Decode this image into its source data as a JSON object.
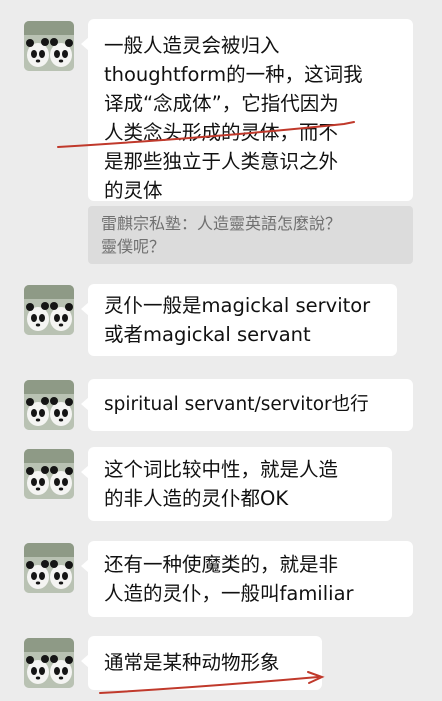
{
  "messages": [
    {
      "lines": [
        "一般人造灵会被归入",
        "thoughtform的一种，这词我",
        "译成“念成体”，它指代因为",
        "人类念头形成的灵体，而不",
        "是那些独立于人类意识之外",
        "的灵体"
      ],
      "quote": {
        "lines": [
          "雷麒宗私塾：人造靈英語怎麼說？",
          "靈僕呢？"
        ]
      }
    },
    {
      "lines": [
        "灵仆一般是magickal servitor",
        "或者magickal servant"
      ]
    },
    {
      "lines": [
        "spiritual servant/servitor也行"
      ]
    },
    {
      "lines": [
        "这个词比较中性，就是人造",
        "的非人造的灵仆都OK"
      ]
    },
    {
      "lines": [
        "还有一种使魔类的，就是非",
        "人造的灵仆，一般叫familiar"
      ]
    },
    {
      "lines": [
        "通常是某种动物形象"
      ]
    }
  ],
  "avatar_icon": "panda-pair-avatar",
  "colors": {
    "background": "#ececec",
    "bubble": "#ffffff",
    "quote_background": "#dcdcdc",
    "quote_text": "#707070",
    "annotation_red": "#c0392b"
  }
}
